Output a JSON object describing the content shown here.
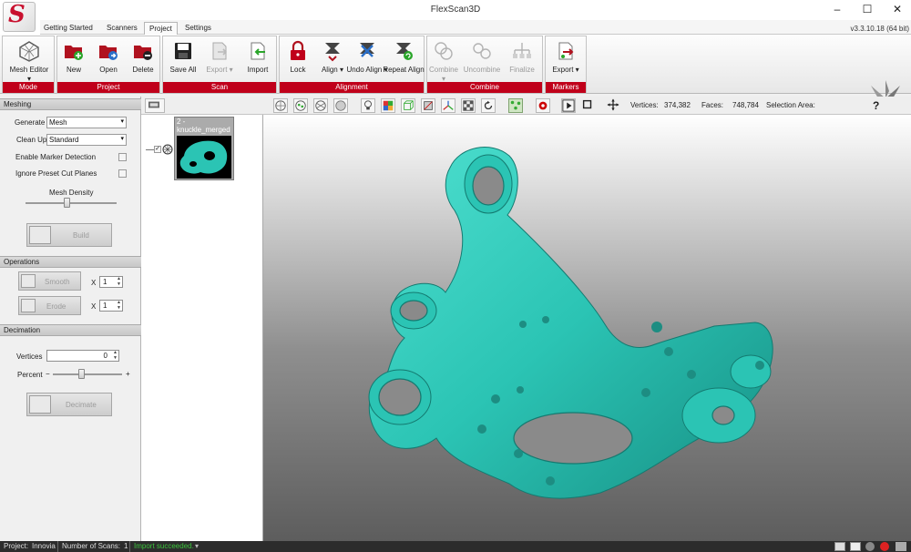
{
  "window": {
    "title": "FlexScan3D",
    "version": "v3.3.10.18  (64 bit)"
  },
  "tabs": [
    {
      "label": "Getting Started"
    },
    {
      "label": "Scanners"
    },
    {
      "label": "Project"
    },
    {
      "label": "Settings"
    }
  ],
  "ribbon": {
    "groups": [
      {
        "label": "Mode"
      },
      {
        "label": "Project"
      },
      {
        "label": "Scan"
      },
      {
        "label": "Alignment"
      },
      {
        "label": "Combine"
      },
      {
        "label": "Markers"
      }
    ],
    "buttons": {
      "mesh_editor": "Mesh Editor",
      "new": "New",
      "open": "Open",
      "delete": "Delete",
      "save_all": "Save All",
      "export": "Export",
      "import": "Import",
      "lock": "Lock",
      "align": "Align",
      "undo_align": "Undo Align",
      "repeat_align": "Repeat Align",
      "combine": "Combine",
      "uncombine": "Uncombine",
      "finalize": "Finalize",
      "markers_export": "Export"
    }
  },
  "meshing": {
    "title": "Meshing",
    "generate_label": "Generate",
    "generate_value": "Mesh",
    "cleanup_label": "Clean Up",
    "cleanup_value": "Standard",
    "enable_marker": "Enable Marker Detection",
    "ignore_cut": "Ignore Preset Cut Planes",
    "density_label": "Mesh Density",
    "density_level": 0.45,
    "build_label": "Build"
  },
  "operations": {
    "title": "Operations",
    "smooth_label": "Smooth",
    "smooth_count": "1",
    "erode_label": "Erode",
    "erode_count": "1",
    "x_label": "X"
  },
  "decimation": {
    "title": "Decimation",
    "vertices_label": "Vertices",
    "vertices_value": "0",
    "percent_label": "Percent",
    "minus": "−",
    "plus": "+",
    "percent_level": 0.4,
    "decimate_label": "Decimate"
  },
  "viewer": {
    "vertices_label": "Vertices:",
    "vertices_value": "374,382",
    "faces_label": "Faces:",
    "faces_value": "748,784",
    "selection_label": "Selection Area:",
    "help": "?"
  },
  "scans": [
    {
      "name": "2 - knuckle_merged"
    }
  ],
  "status": {
    "project_label": "Project:",
    "project_value": "Innovia",
    "scans_label": "Number of Scans:",
    "scans_value": "1",
    "message": "Import succeeded."
  },
  "colors": {
    "accent": "#c0001a",
    "mesh": "#2bc4b4",
    "status_ok": "#3cc43c"
  }
}
